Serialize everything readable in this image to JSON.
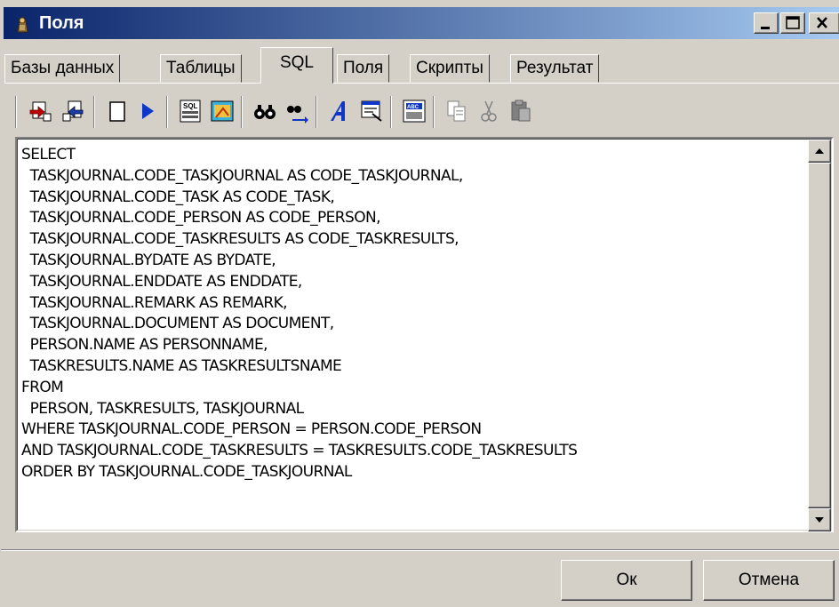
{
  "window": {
    "title": "Поля"
  },
  "tabs": [
    {
      "label": "Базы данных"
    },
    {
      "label": "Таблицы"
    },
    {
      "label": "SQL"
    },
    {
      "label": "Поля"
    },
    {
      "label": "Скрипты"
    },
    {
      "label": "Результат"
    }
  ],
  "active_tab": "SQL",
  "toolbar": {
    "icons": [
      "open-db-icon",
      "save-db-icon",
      "new-query-icon",
      "run-icon",
      "sql-builder-icon",
      "query-designer-icon",
      "find-icon",
      "find-next-icon",
      "font-icon",
      "properties-icon",
      "format-sql-icon",
      "copy-icon",
      "cut-icon",
      "paste-icon"
    ]
  },
  "sql": {
    "text": "SELECT\n  TASKJOURNAL.CODE_TASKJOURNAL AS CODE_TASKJOURNAL,\n  TASKJOURNAL.CODE_TASK AS CODE_TASK,\n  TASKJOURNAL.CODE_PERSON AS CODE_PERSON,\n  TASKJOURNAL.CODE_TASKRESULTS AS CODE_TASKRESULTS,\n  TASKJOURNAL.BYDATE AS BYDATE,\n  TASKJOURNAL.ENDDATE AS ENDDATE,\n  TASKJOURNAL.REMARK AS REMARK,\n  TASKJOURNAL.DOCUMENT AS DOCUMENT,\n  PERSON.NAME AS PERSONNAME,\n  TASKRESULTS.NAME AS TASKRESULTSNAME\nFROM\n  PERSON, TASKRESULTS, TASKJOURNAL\nWHERE TASKJOURNAL.CODE_PERSON = PERSON.CODE_PERSON\nAND TASKJOURNAL.CODE_TASKRESULTS = TASKRESULTS.CODE_TASKRESULTS\nORDER BY TASKJOURNAL.CODE_TASKJOURNAL"
  },
  "buttons": {
    "ok": "Ок",
    "cancel": "Отмена"
  },
  "colors": {
    "title_start": "#0a246a",
    "title_end": "#a6caf0",
    "face": "#d4d0c8"
  }
}
